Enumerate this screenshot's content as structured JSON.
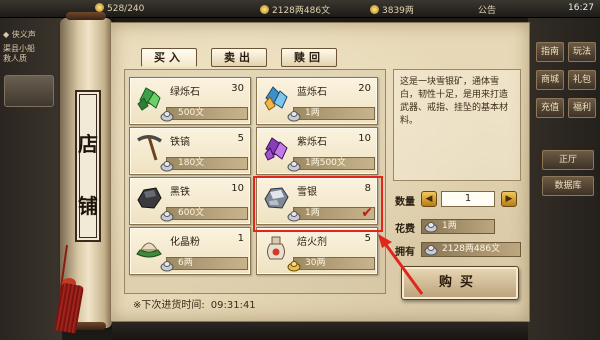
{
  "topbar": {
    "stat_left": "528/240",
    "stat_mid": "2128两486文",
    "stat_right": "3839两",
    "notice": "公告",
    "clock": "16:27"
  },
  "left_panel": {
    "title": "◆ 侠义声",
    "line1": "渠县小船",
    "line2": "救人质"
  },
  "right_side": {
    "buttons": [
      "指南",
      "玩法",
      "商城",
      "礼包",
      "充值",
      "福利"
    ],
    "bottom_buttons": [
      "正厅",
      "数据库"
    ]
  },
  "shop": {
    "sign": [
      "店",
      "铺"
    ],
    "tabs": [
      {
        "label": "买入",
        "active": true
      },
      {
        "label": "卖出",
        "active": false
      },
      {
        "label": "赎回",
        "active": false
      }
    ],
    "items": [
      {
        "name": "绿烁石",
        "stock": "30",
        "price": "500文",
        "icon": "green-crystal-icon"
      },
      {
        "name": "蓝烁石",
        "stock": "20",
        "price": "1两",
        "icon": "blue-crystal-icon"
      },
      {
        "name": "铁镐",
        "stock": "5",
        "price": "180文",
        "icon": "pickaxe-icon"
      },
      {
        "name": "紫烁石",
        "stock": "10",
        "price": "1两500文",
        "icon": "purple-crystal-icon"
      },
      {
        "name": "黑铁",
        "stock": "10",
        "price": "600文",
        "icon": "black-iron-icon"
      },
      {
        "name": "雪银",
        "stock": "8",
        "price": "1两",
        "icon": "snow-silver-icon",
        "selected": true
      },
      {
        "name": "化晶粉",
        "stock": "1",
        "price": "6两",
        "icon": "crystal-powder-icon"
      },
      {
        "name": "焙火剂",
        "stock": "5",
        "price": "30两",
        "icon": "fire-agent-icon"
      }
    ],
    "restock_label": "※下次进货时间:",
    "restock_time": "09:31:41",
    "description": "这是一块雪银矿，通体雪白，韧性十足，是用来打造武器、戒指、挂坠的基本材料。",
    "quantity_label": "数量",
    "quantity_value": "1",
    "cost_label": "花费",
    "cost_value": "1两",
    "owned_label": "拥有",
    "owned_value": "2128两486文",
    "buy_label": "购买",
    "colors": {
      "highlight": "#e2261b",
      "parchment": "#e7d9b7"
    }
  }
}
